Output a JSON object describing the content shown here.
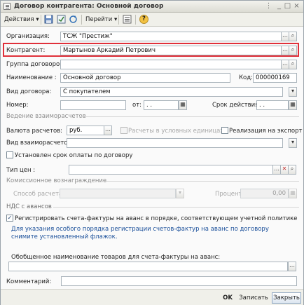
{
  "window": {
    "title": "Договор контрагента: Основной договор"
  },
  "toolbar": {
    "actions_label": "Действия",
    "goto_label": "Перейти",
    "help_label": "?"
  },
  "form": {
    "organization": {
      "label": "Организация:",
      "value": "ТСЖ \"Престиж\""
    },
    "counterparty": {
      "label": "Контрагент:",
      "value": "Мартынов Аркадий Петрович"
    },
    "contract_group": {
      "label": "Группа договоров:",
      "value": ""
    },
    "name": {
      "label": "Наименование :",
      "value": "Основной договор"
    },
    "code": {
      "label": "Код:",
      "value": "000000169"
    },
    "contract_type": {
      "label": "Вид договора:",
      "value": "С покупателем"
    },
    "number": {
      "label": "Номер:",
      "value": ""
    },
    "date_from": {
      "label": "от:",
      "value": ". ."
    },
    "validity": {
      "label": "Срок действия:",
      "value": ". ."
    }
  },
  "settlements": {
    "section_title": "Ведение взаиморасчетов",
    "currency": {
      "label": "Валюта расчетов:",
      "value": "руб."
    },
    "conventional_units_label": "Расчеты в условных единицах",
    "export_label": "Реализация на экспорт",
    "settlement_type": {
      "label": "Вид взаиморасчетов:",
      "value": ""
    },
    "payment_term_label": "Установлен срок оплаты по договору"
  },
  "price_type": {
    "label": "Тип цен :",
    "value": ""
  },
  "commission": {
    "section_title": "Комиссионное вознаграждение",
    "calc_method": {
      "label": "Способ расчета:",
      "value": ""
    },
    "percent": {
      "label": "Процент:",
      "value": "0,00"
    }
  },
  "vat": {
    "section_title": "НДС с авансов",
    "register_invoices_label": "Регистрировать счета-фактуры на аванс в порядке, соответствующем учетной политике",
    "register_invoices_checked": true,
    "note": "Для указания особого порядка регистрации счетов-фактур на аванс по договору снимите установленный флажок.",
    "goods_name_label": "Обобщенное наименование товаров для счета-фактуры на аванс:",
    "goods_name_value": ""
  },
  "comment": {
    "label": "Комментарий:",
    "value": ""
  },
  "buttons": {
    "ok": "OK",
    "save": "Записать",
    "close": "Закрыть"
  },
  "icons": {
    "select": "…",
    "open": "open-icon",
    "clear": "✕",
    "calendar": "calendar-icon",
    "dropdown": "▾"
  },
  "colors": {
    "highlight": "#e0303a",
    "note": "#1a4f9a"
  }
}
